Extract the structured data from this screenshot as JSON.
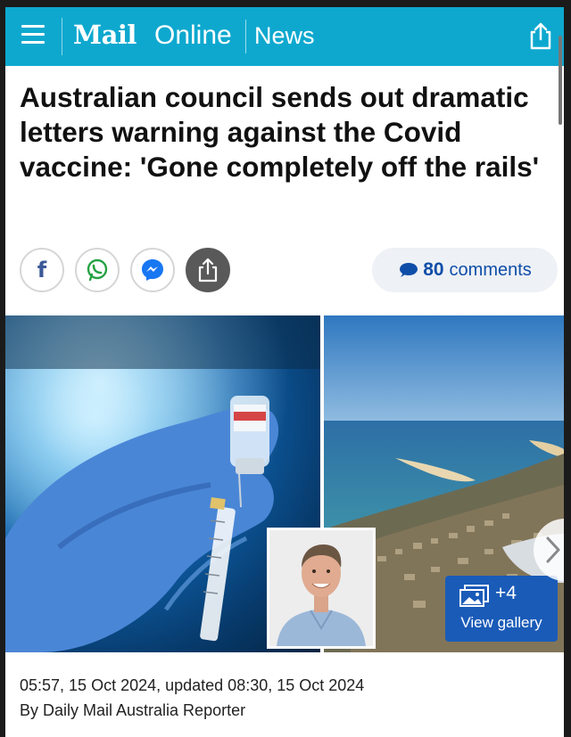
{
  "header": {
    "logo_mail": "Mail",
    "logo_online": "Online",
    "section": "News",
    "menu_icon": "hamburger-menu-icon",
    "share_icon": "share-upload-icon",
    "bg_color": "#0ea8cf"
  },
  "article": {
    "headline": "Australian council sends out dramatic letters warning against the Covid vaccine: 'Gone completely off the rails'",
    "timestamp": "05:57, 15 Oct 2024, updated 08:30, 15 Oct 2024",
    "byline": "By Daily Mail Australia Reporter"
  },
  "social": {
    "facebook_glyph": "f",
    "icons": [
      "facebook-icon",
      "whatsapp-icon",
      "messenger-icon",
      "share-icon"
    ]
  },
  "comments": {
    "count": "80",
    "word": "comments",
    "icon": "speech-bubble-icon",
    "color": "#0f4ea8"
  },
  "gallery": {
    "count": "+4",
    "label": "View gallery",
    "icon": "gallery-images-icon",
    "color": "#1a5bb8"
  }
}
